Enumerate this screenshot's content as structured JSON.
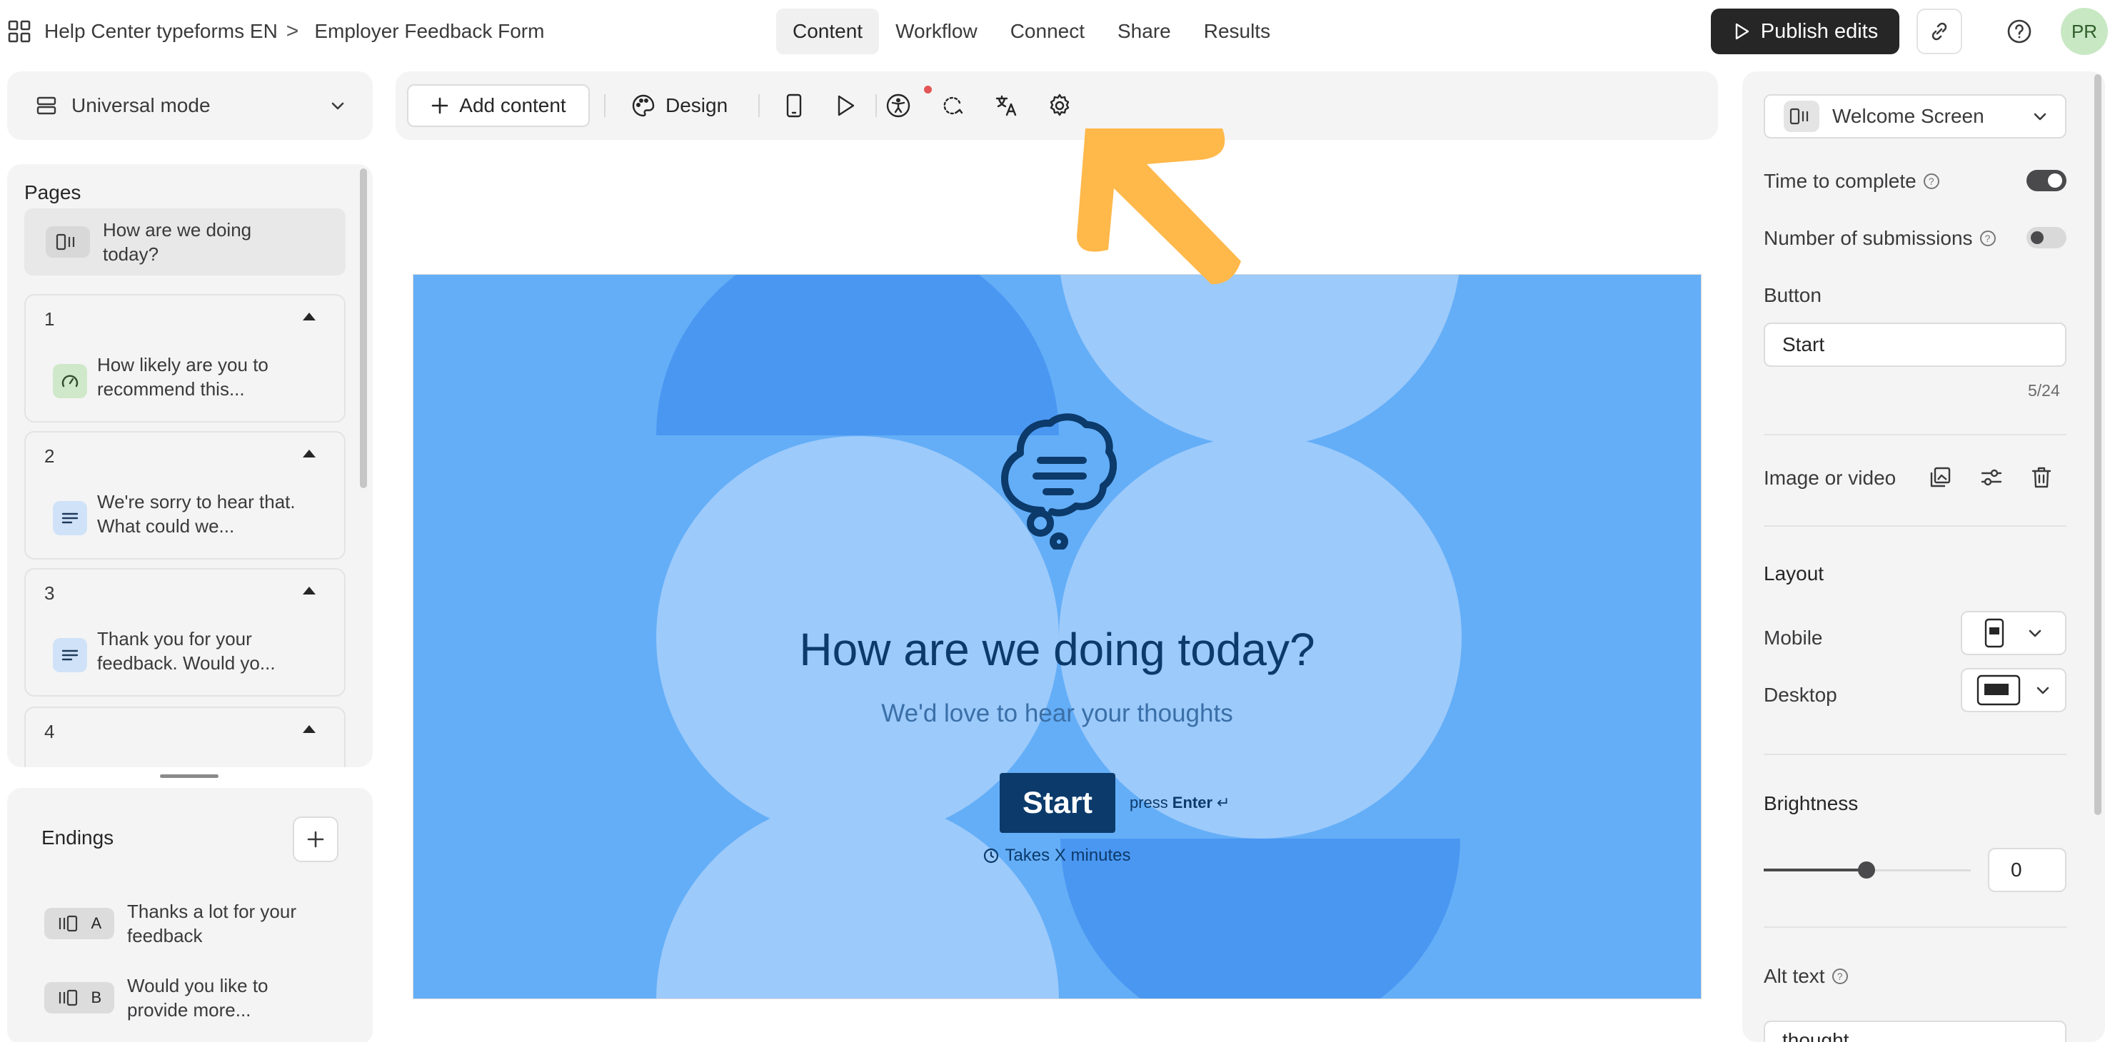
{
  "header": {
    "breadcrumb_workspace": "Help Center typeforms EN",
    "breadcrumb_separator": ">",
    "form_title": "Employer Feedback Form",
    "tabs": [
      {
        "label": "Content"
      },
      {
        "label": "Workflow"
      },
      {
        "label": "Connect"
      },
      {
        "label": "Share"
      },
      {
        "label": "Results"
      }
    ],
    "publish_label": "Publish edits",
    "avatar_initials": "PR"
  },
  "left": {
    "mode_label": "Universal mode",
    "pages_title": "Pages",
    "welcome_text": "How are we doing today?",
    "questions": [
      {
        "number": "1",
        "text": "How likely are you to recommend this...",
        "icon": "gauge-icon",
        "color": "#cfe8c9"
      },
      {
        "number": "2",
        "text": "We're sorry to hear that. What could we...",
        "icon": "lines-icon",
        "color": "#cfe2f8"
      },
      {
        "number": "3",
        "text": "Thank you for your feedback. Would yo...",
        "icon": "lines-icon",
        "color": "#cfe2f8"
      },
      {
        "number": "4",
        "text": "",
        "icon": "",
        "color": "#cfe2f8"
      }
    ],
    "endings_title": "Endings",
    "endings": [
      {
        "letter": "A",
        "text": "Thanks a lot for your feedback"
      },
      {
        "letter": "B",
        "text": "Would you like to provide more..."
      }
    ]
  },
  "toolbar": {
    "add_content_label": "Add content",
    "design_label": "Design"
  },
  "preview": {
    "headline": "How are we doing today?",
    "subline": "We'd love to hear your thoughts",
    "start_label": "Start",
    "press_prefix": "press",
    "press_key": "Enter",
    "press_symbol": "↵",
    "takes_text": "Takes X minutes",
    "bg_color": "#64aef7",
    "text_color": "#0b3a6b"
  },
  "right": {
    "screen_select": "Welcome Screen",
    "time_to_complete_label": "Time to complete",
    "time_to_complete_on": true,
    "submissions_label": "Number of submissions",
    "submissions_on": false,
    "button_heading": "Button",
    "button_value": "Start",
    "button_counter": "5/24",
    "image_video_label": "Image or video",
    "layout_heading": "Layout",
    "mobile_label": "Mobile",
    "desktop_label": "Desktop",
    "brightness_heading": "Brightness",
    "brightness_value": "0",
    "alt_text_heading": "Alt text",
    "alt_text_value": "thought"
  },
  "colors": {
    "accent_arrow": "#ffb84a",
    "dark": "#262627"
  }
}
